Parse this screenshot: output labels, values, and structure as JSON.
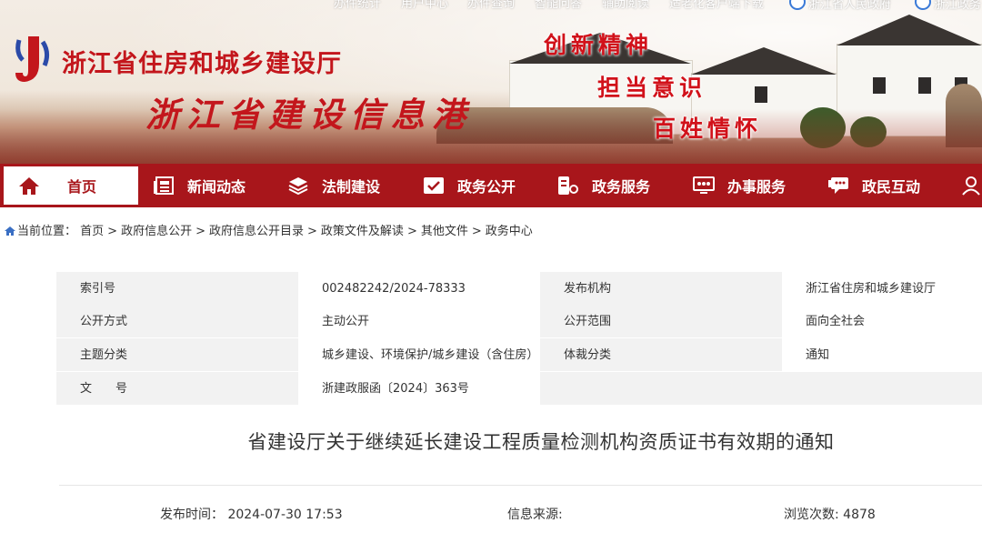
{
  "top_links": [
    "办件统计",
    "用户中心",
    "办件查询",
    "智能问答",
    "辅助阅读",
    "适老化客户端下载",
    "浙江省人民政府",
    "浙江政务"
  ],
  "header": {
    "site_name": "浙江省住房和城乡建设厅",
    "site_sub": "浙江省建设信息港",
    "slogans": [
      "创新精神",
      "担当意识",
      "百姓情怀"
    ]
  },
  "nav": {
    "items": [
      {
        "label": "首页",
        "icon": "home-icon"
      },
      {
        "label": "新闻动态",
        "icon": "newspaper-icon"
      },
      {
        "label": "法制建设",
        "icon": "layers-icon"
      },
      {
        "label": "政务公开",
        "icon": "mail-check-icon"
      },
      {
        "label": "政务服务",
        "icon": "service-icon"
      },
      {
        "label": "办事服务",
        "icon": "monitor-icon"
      },
      {
        "label": "政民互动",
        "icon": "chat-icon"
      }
    ]
  },
  "breadcrumb": {
    "prefix": "当前位置：",
    "items": [
      "首页",
      "政府信息公开",
      "政府信息公开目录",
      "政策文件及解读",
      "其他文件",
      "政务中心"
    ]
  },
  "info": {
    "rows": [
      {
        "l1": "索引号",
        "v1": "002482242/2024-78333",
        "l2": "发布机构",
        "v2": "浙江省住房和城乡建设厅"
      },
      {
        "l1": "公开方式",
        "v1": "主动公开",
        "l2": "公开范围",
        "v2": "面向全社会"
      },
      {
        "l1": "主题分类",
        "v1": "城乡建设、环境保护/城乡建设（含住房）",
        "l2": "体裁分类",
        "v2": "通知"
      },
      {
        "l1": "文　　号",
        "v1": "浙建政服函〔2024〕363号",
        "l2": "",
        "v2": ""
      }
    ]
  },
  "article": {
    "title": "省建设厅关于继续延长建设工程质量检测机构资质证书有效期的通知",
    "publish_label": "发布时间：",
    "publish_time": "2024-07-30 17:53",
    "source_label": "信息来源:",
    "views_label": "浏览次数: ",
    "views": "4878"
  },
  "colors": {
    "brand_red": "#a8161b",
    "title_red": "#c3161c",
    "label_bg": "#f2f2f2"
  }
}
